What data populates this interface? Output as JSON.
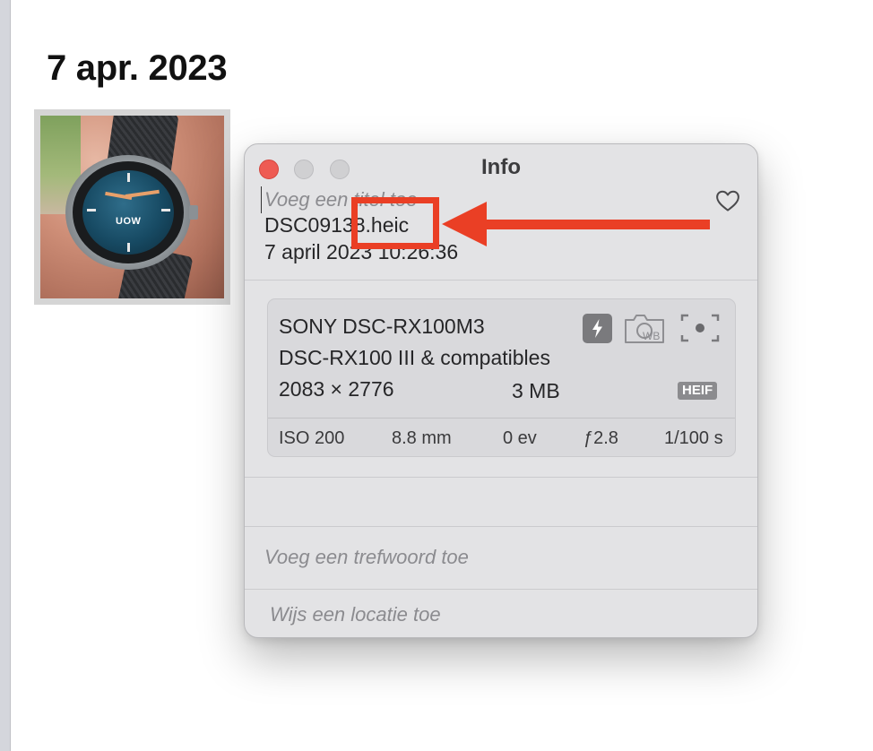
{
  "library": {
    "date_heading": "7 apr. 2023",
    "thumbnail": {
      "watch_logo": "UOW"
    }
  },
  "info_panel": {
    "title": "Info",
    "title_placeholder": "Voeg een titel toe",
    "filename": "DSC09138.heic",
    "datetime": "7 april 2023   10:26:36",
    "favorite_icon": "heart-outline-icon",
    "window_controls": [
      "close",
      "minimize",
      "zoom"
    ],
    "camera": {
      "model": "SONY DSC-RX100M3",
      "lens": "DSC-RX100 III & compatibles",
      "dimensions": "2083 × 2776",
      "file_size": "3 MB",
      "format_badge": "HEIF",
      "icons": [
        "flash-icon",
        "white-balance-icon",
        "metering-icon"
      ]
    },
    "exif": {
      "iso": "ISO 200",
      "focal_length": "8.8 mm",
      "exposure_bias": "0 ev",
      "aperture": "ƒ2.8",
      "shutter": "1/100 s"
    },
    "keyword_placeholder": "Voeg een trefwoord toe",
    "location_placeholder": "Wijs een locatie toe"
  },
  "annotation": {
    "color": "#ea3f25"
  },
  "colors": {
    "close_button": "#ee5b53",
    "panel_background": "#e3e3e5",
    "badge": "#8b8b8e"
  }
}
